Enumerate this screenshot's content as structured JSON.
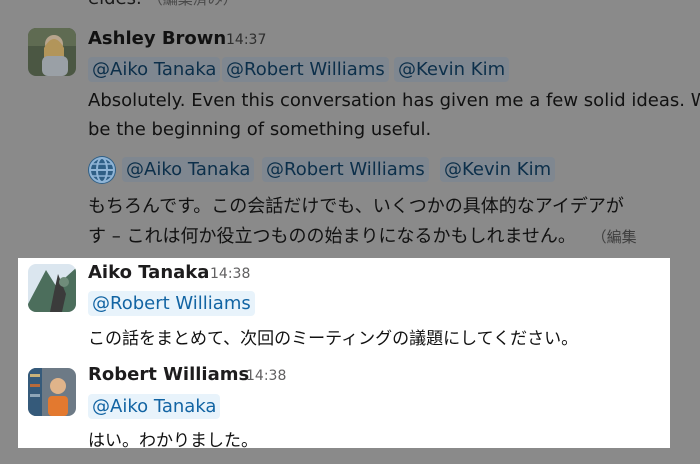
{
  "top_fragment": {
    "text": "eides.",
    "edited": "（編集済み）"
  },
  "messages_dimmed": [
    {
      "author": "Ashley Brown",
      "time": "14:37",
      "mentions": [
        "@Aiko Tanaka",
        "@Robert Williams",
        "@Kevin Kim"
      ],
      "text_line1": "Absolutely. Even this conversation has given me a few solid ideas. W",
      "text_line2": "be the beginning of something useful.",
      "translation_mentions": [
        "@Aiko Tanaka",
        "@Robert Williams",
        "@Kevin Kim"
      ],
      "translation_line1": "もちろんです。この会話だけでも、いくつかの具体的なアイデアが",
      "translation_line2": "す – これは何か役立つものの始まりになるかもしれません。",
      "translation_edited": "（編集"
    }
  ],
  "messages_highlighted": [
    {
      "author": "Aiko Tanaka",
      "time": "14:38",
      "mention": "@Robert Williams",
      "text": "この話をまとめて、次回のミーティングの議題にしてください。"
    },
    {
      "author": "Robert Williams",
      "time": "14:38",
      "mention": "@Aiko Tanaka",
      "text": "はい。わかりました。"
    }
  ],
  "icons": {
    "translate": "globe-icon"
  },
  "colors": {
    "mention_text": "#1264a3",
    "mention_bg": "#e8f3fb",
    "overlay": "#8a8a8a"
  }
}
